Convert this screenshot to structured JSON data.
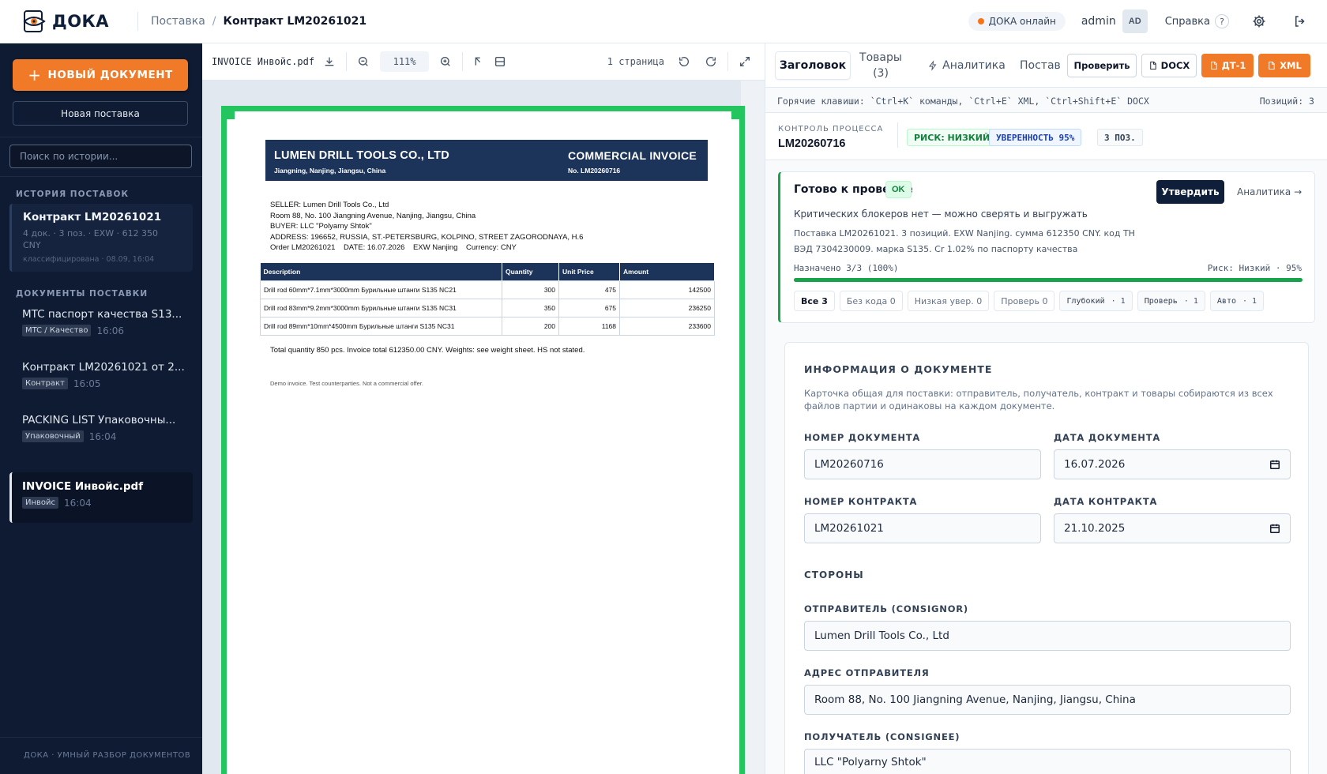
{
  "topbar": {
    "logo_text": "ДОКА",
    "breadcrumb_parent": "Поставка",
    "breadcrumb_sep": "/",
    "breadcrumb_current": "Контракт LM20261021",
    "online_label": "ДОКА онлайн",
    "user": "admin",
    "avatar": "AD",
    "help_label": "Справка",
    "help_q": "?"
  },
  "sidebar": {
    "new_doc_label": "НОВЫЙ ДОКУМЕНТ",
    "new_ship_label": "Новая поставка",
    "search_placeholder": "Поиск по истории...",
    "history_header": "ИСТОРИЯ ПОСТАВОК",
    "history": {
      "title": "Контракт LM20261021",
      "meta": "4 док. · 3 поз. · EXW · 612 350 CNY",
      "sub": "классифицирована · 08.09, 16:04"
    },
    "docs_header": "ДОКУМЕНТЫ ПОСТАВКИ",
    "docs": [
      {
        "name": "MTC паспорт качества S13...",
        "tag": "MTC / Качество",
        "time": "16:06"
      },
      {
        "name": "Контракт LM20261021 от 2...",
        "tag": "Контракт",
        "time": "16:05"
      },
      {
        "name": "PACKING LIST Упаковочны...",
        "tag": "Упаковочный",
        "time": "16:04"
      },
      {
        "name": "INVOICE Инвойс.pdf",
        "tag": "Инвойс",
        "time": "16:04"
      }
    ],
    "footer": "ДОКА · УМНЫЙ РАЗБОР ДОКУМЕНТОВ"
  },
  "viewer": {
    "filename": "INVOICE Инвойс.pdf",
    "zoom": "111%",
    "pages": "1 страница",
    "invoice": {
      "company": "LUMEN DRILL TOOLS CO., LTD",
      "company_addr": "Jiangning, Nanjing, Jiangsu, China",
      "doc_type": "COMMERCIAL INVOICE",
      "doc_no": "No. LM20260716",
      "seller": "SELLER: Lumen Drill Tools Co., Ltd",
      "seller_addr": "Room 88, No. 100 Jiangning Avenue, Nanjing, Jiangsu, China",
      "buyer": "BUYER: LLC \"Polyarny Shtok\"",
      "buyer_addr": "ADDRESS: 196652, RUSSIA, ST.-PETERSBURG, KOLPINO, STREET ZAGORODNAYA, H.6",
      "order_line": "Order LM20261021    DATE: 16.07.2026    EXW Nanjing    Currency: CNY",
      "columns": [
        "Description",
        "Quantity",
        "Unit Price",
        "Amount"
      ],
      "rows": [
        [
          "Drill rod 60mm*7.1mm*3000mm Бурильные штанги S135 NC21",
          "300",
          "475",
          "142500"
        ],
        [
          "Drill rod 83mm*9.2mm*3000mm Бурильные штанги S135 NC31",
          "350",
          "675",
          "236250"
        ],
        [
          "Drill rod 89mm*10mm*4500mm Бурильные штанги S135 NC31",
          "200",
          "1168",
          "233600"
        ]
      ],
      "total": "Total quantity 850 pcs. Invoice total 612350.00 CNY. Weights: see weight sheet. HS not stated.",
      "demo": "Demo invoice. Test counterparties. Not a commercial offer."
    }
  },
  "right": {
    "tabs": {
      "header": "Заголовок",
      "goods": "Товары",
      "goods_count": "(3)",
      "analytics": "Аналитика",
      "supply": "Постав"
    },
    "btn_check": "Проверить",
    "btn_docx": "DOCX",
    "btn_dt1": "ДТ-1",
    "btn_xml": "XML",
    "hotkeys": "Горячие клавиши: `Ctrl+K` команды, `Ctrl+E` XML, `Ctrl+Shift+E` DOCX",
    "positions": "Позиций: 3",
    "process_label": "КОНТРОЛЬ ПРОЦЕССА",
    "process_id": "LM20260716",
    "risk": "РИСК: НИЗКИЙ",
    "confidence": "УВЕРЕННОСТЬ 95%",
    "pos_count": "3 ПОЗ.",
    "ready": {
      "title": "Готово к проверке",
      "ok": "OK",
      "approve": "Утвердить",
      "analytics_link": "Аналитика →",
      "subtitle": "Критических блокеров нет — можно сверять и выгружать",
      "desc_1": "Поставка LM20261021. 3 позиций. EXW Nanjing. сумма 612350 CNY. код ТН",
      "desc_2": "ВЭД 7304230009. марка S135. Cr 1.02% по паспорту качества",
      "progress_label": "Назначено 3/3 (100%)",
      "progress_value": 1.0,
      "risk_line": "Риск: Низкий · 95%",
      "filters": [
        {
          "label": "Все 3",
          "count": ""
        },
        {
          "label": "Без кода 0",
          "count": ""
        },
        {
          "label": "Низкая увер. 0",
          "count": ""
        },
        {
          "label": "Проверь 0",
          "count": ""
        },
        {
          "label": "Глубокий",
          "count": "· 1"
        },
        {
          "label": "Проверь",
          "count": "· 1"
        },
        {
          "label": "Авто",
          "count": "· 1"
        }
      ]
    },
    "card": {
      "title": "ИНФОРМАЦИЯ О ДОКУМЕНТЕ",
      "note": "Карточка общая для поставки: отправитель, получатель, контракт и товары собираются из всех файлов партии и одинаковы на каждом документе.",
      "doc_no_label": "НОМЕР ДОКУМЕНТА",
      "doc_no": "LM20260716",
      "doc_date_label": "ДАТА ДОКУМЕНТА",
      "doc_date": "16.07.2026",
      "contract_no_label": "НОМЕР КОНТРАКТА",
      "contract_no": "LM20261021",
      "contract_date_label": "ДАТА КОНТРАКТА",
      "contract_date": "21.10.2025",
      "parties": "СТОРОНЫ",
      "consignor_label": "ОТПРАВИТЕЛЬ (CONSIGNOR)",
      "consignor": "Lumen Drill Tools Co., Ltd",
      "consignor_addr_label": "АДРЕС ОТПРАВИТЕЛЯ",
      "consignor_addr": "Room 88, No. 100 Jiangning Avenue, Nanjing, Jiangsu, China",
      "consignee_label": "ПОЛУЧАТЕЛЬ (CONSIGNEE)",
      "consignee": "LLC \"Polyarny Shtok\""
    }
  }
}
